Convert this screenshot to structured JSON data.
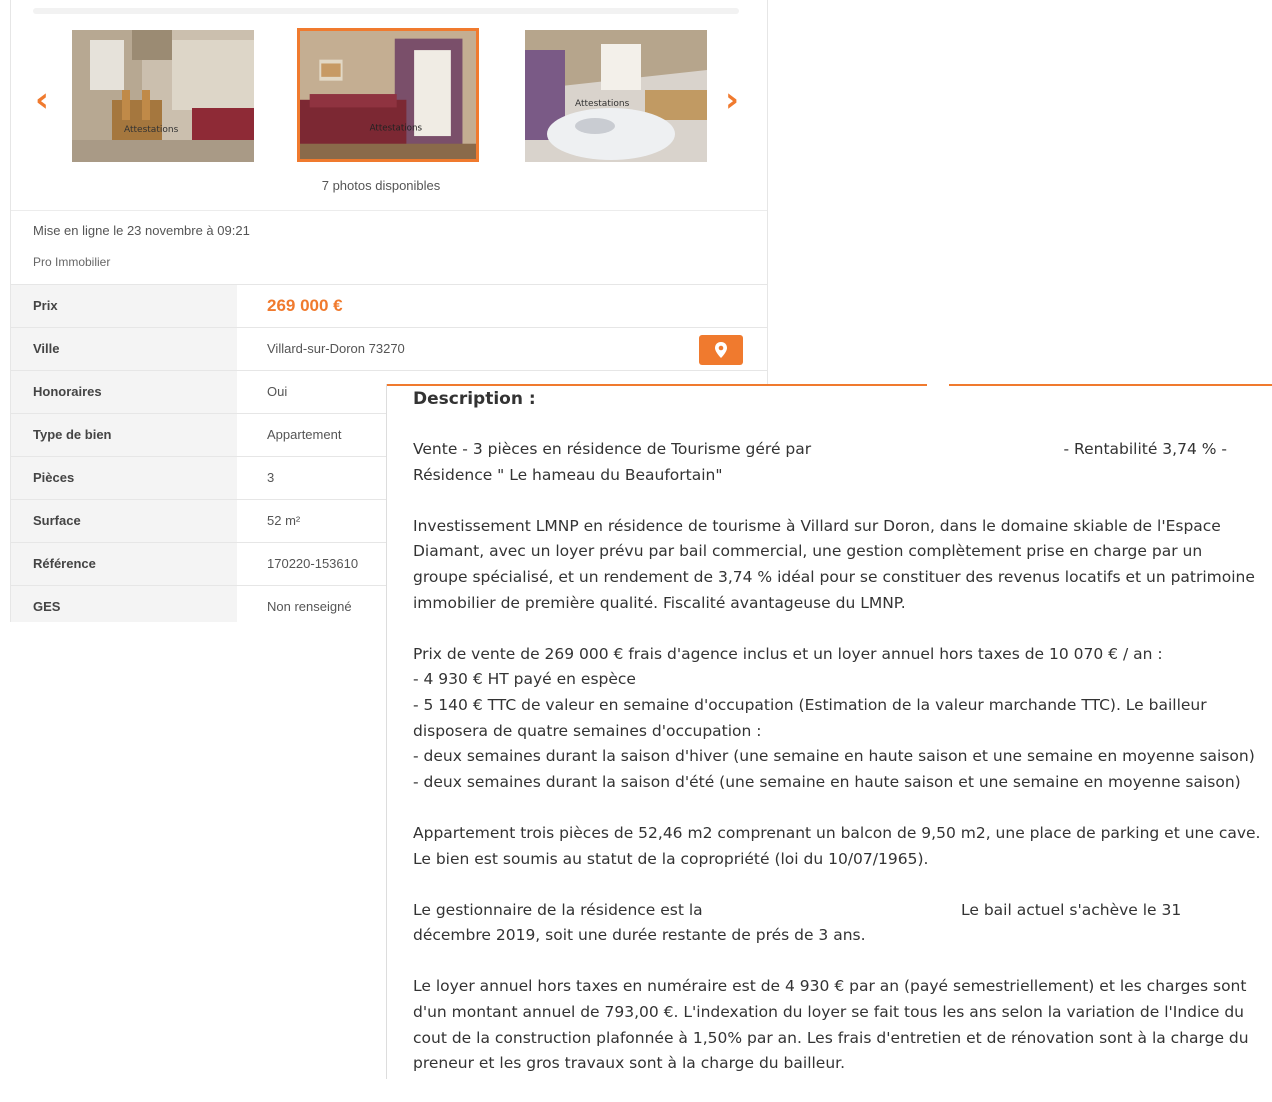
{
  "gallery": {
    "prev_arrow": "‹",
    "next_arrow": "›",
    "photos": [
      {
        "watermark": "Attestations"
      },
      {
        "watermark": "Attestations"
      },
      {
        "watermark": "Attestations"
      }
    ],
    "photo_count_label": "7 photos disponibles"
  },
  "listing": {
    "published": "Mise en ligne le 23 novembre à 09:21",
    "seller_type": "Pro Immobilier",
    "properties": [
      {
        "label": "Prix",
        "value": "269 000 €"
      },
      {
        "label": "Ville",
        "value": "Villard-sur-Doron 73270"
      },
      {
        "label": "Honoraires",
        "value": "Oui"
      },
      {
        "label": "Type de bien",
        "value": "Appartement"
      },
      {
        "label": "Pièces",
        "value": "3"
      },
      {
        "label": "Surface",
        "value": "52 m²"
      },
      {
        "label": "Référence",
        "value": "170220-153610"
      },
      {
        "label": "GES",
        "value": "Non renseigné"
      }
    ],
    "accent_color": "#f07a2e"
  },
  "description": {
    "title": "Description :",
    "p1_line1_left": "Vente - 3 pièces en résidence de Tourisme géré par",
    "p1_line1_right": "- Rentabilité 3,74 % -",
    "p1_line2": "Résidence \" Le hameau du Beaufortain\"",
    "p2_lines": [
      "Investissement LMNP en résidence de tourisme à Villard sur Doron, dans le domaine skiable de l'Espace",
      "Diamant, avec un loyer prévu par bail commercial, une gestion complètement prise en charge par un",
      "groupe spécialisé, et un rendement de 3,74 % idéal pour se constituer des revenus locatifs et un patrimoine",
      "immobilier de première qualité. Fiscalité avantageuse du LMNP."
    ],
    "p3_lines": [
      "Prix de vente de 269 000 € frais d'agence inclus et un loyer annuel hors taxes de 10 070 € / an :",
      "- 4 930 € HT payé en espèce",
      "- 5 140 € TTC de valeur en semaine d'occupation (Estimation de la valeur marchande TTC). Le bailleur",
      "disposera de quatre semaines d'occupation :",
      "- deux semaines durant la saison d'hiver (une semaine en haute saison et une semaine en moyenne saison)",
      "- deux semaines durant la saison d'été (une semaine en haute saison et une semaine en moyenne saison)"
    ],
    "p4_lines": [
      "Appartement trois pièces de 52,46 m2 comprenant un balcon de 9,50 m2, une place de parking et une cave.",
      "Le bien est soumis au statut de la copropriété (loi du 10/07/1965)."
    ],
    "p5_line1_left": "Le gestionnaire de la résidence est la",
    "p5_line1_right": "Le bail actuel s'achève le 31",
    "p5_line2": "décembre 2019, soit une durée restante de prés de 3 ans.",
    "p6_lines": [
      "Le loyer annuel hors taxes en numéraire est de 4 930 € par an (payé semestriellement) et les charges sont",
      "d'un montant annuel de 793,00 €. L'indexation du loyer se fait tous les ans selon la variation de l'Indice du",
      "cout de la construction plafonnée à 1,50% par an. Les frais d'entretien et de rénovation sont à la charge du",
      "preneur et les gros travaux sont à la charge du bailleur."
    ]
  }
}
